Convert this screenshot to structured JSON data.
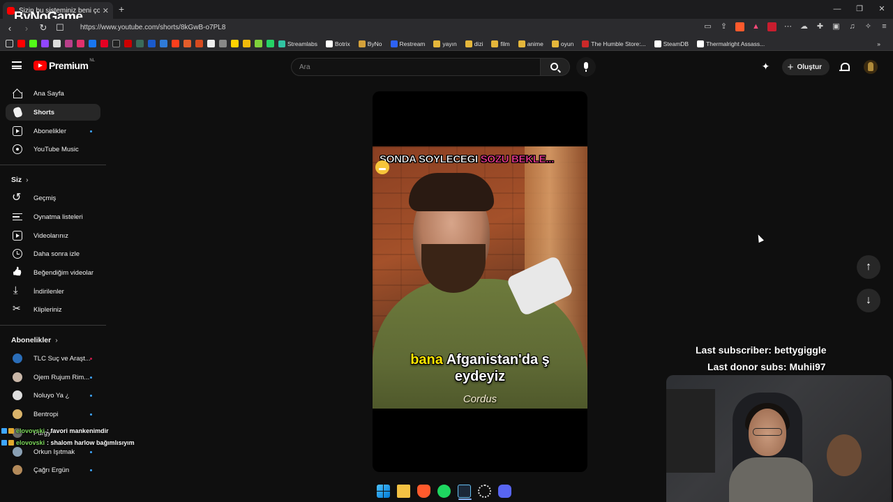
{
  "browser": {
    "tab_title": "Sizin bu sisteminiz beni çok d",
    "tab_close": "✕",
    "new_tab": "+",
    "brand_overlay": "ByNoGame",
    "url": "https://www.youtube.com/shorts/8kGwB-o7PL8",
    "window_controls": [
      "—",
      "❐",
      "✕"
    ],
    "bookmarks": [
      {
        "label": "Streamlabs",
        "color": "#31c3a2"
      },
      {
        "label": "Botrix",
        "color": "#ffffff"
      },
      {
        "label": "ByNo",
        "color": "#d4a13a"
      },
      {
        "label": "Restream",
        "color": "#2d62f6"
      },
      {
        "label": "yayın",
        "color": "#e5b73b",
        "folder": true
      },
      {
        "label": "dizi",
        "color": "#e5b73b",
        "folder": true
      },
      {
        "label": "film",
        "color": "#e5b73b",
        "folder": true
      },
      {
        "label": "anime",
        "color": "#e5b73b",
        "folder": true
      },
      {
        "label": "oyun",
        "color": "#e5b73b",
        "folder": true
      },
      {
        "label": "The Humble Store:...",
        "color": "#cc2929"
      },
      {
        "label": "SteamDB",
        "color": "#ffffff"
      },
      {
        "label": "Thermalright Assass...",
        "color": "#ffffff"
      }
    ],
    "bookmark_more": "»"
  },
  "youtube": {
    "logo_text": "Premium",
    "logo_region": "NL",
    "search_placeholder": "Ara",
    "create_label": "Oluştur",
    "create_plus": "+"
  },
  "sidebar": {
    "main": [
      {
        "label": "Ana Sayfa"
      },
      {
        "label": "Shorts"
      },
      {
        "label": "Abonelikler"
      },
      {
        "label": "YouTube Music"
      }
    ],
    "you_title": "Siz",
    "you_chevron": "›",
    "you": [
      {
        "label": "Geçmiş"
      },
      {
        "label": "Oynatma listeleri"
      },
      {
        "label": "Videolarınız"
      },
      {
        "label": "Daha sonra izle"
      },
      {
        "label": "Beğendiğim videolar"
      },
      {
        "label": "İndirilenler"
      },
      {
        "label": "Klipleriniz"
      }
    ],
    "subs_title": "Abonelikler",
    "subs_chevron": "›",
    "subs": [
      {
        "label": "TLC Suç ve Araşt...",
        "color": "#2a6db8"
      },
      {
        "label": "Ojem Rujum Rim...",
        "color": "#c9b7a8"
      },
      {
        "label": "Noluyo Ya ¿",
        "color": "#dddddd"
      },
      {
        "label": "Bentropi",
        "color": "#d9b36a"
      },
      {
        "label": "Purgy",
        "color": "#6a6a6a"
      },
      {
        "label": "Orkun Işıtmak",
        "color": "#8aa0b4"
      },
      {
        "label": "Çağrı Ergün",
        "color": "#b38a5a"
      }
    ]
  },
  "chat": [
    {
      "user": "elovovski",
      "sep": ":",
      "message": "favori mankenimdir"
    },
    {
      "user": "elovovski",
      "sep": ":",
      "message": "shalom harlow bağımlısıyım"
    }
  ],
  "short": {
    "overlay_white": "SONDA SOYLECEGI ",
    "overlay_pink": "SOZU BEKLE...",
    "caption_yellow": "bana",
    "caption_rest": " Afganistan'da ş",
    "caption_line2": "eydeyiz",
    "credit": "Cordus"
  },
  "shorts_nav": {
    "up": "↑",
    "down": "↓"
  },
  "stream": {
    "last_subscriber": "Last subscriber: bettygiggle",
    "last_donor": "Last donor subs: Muhii97"
  }
}
